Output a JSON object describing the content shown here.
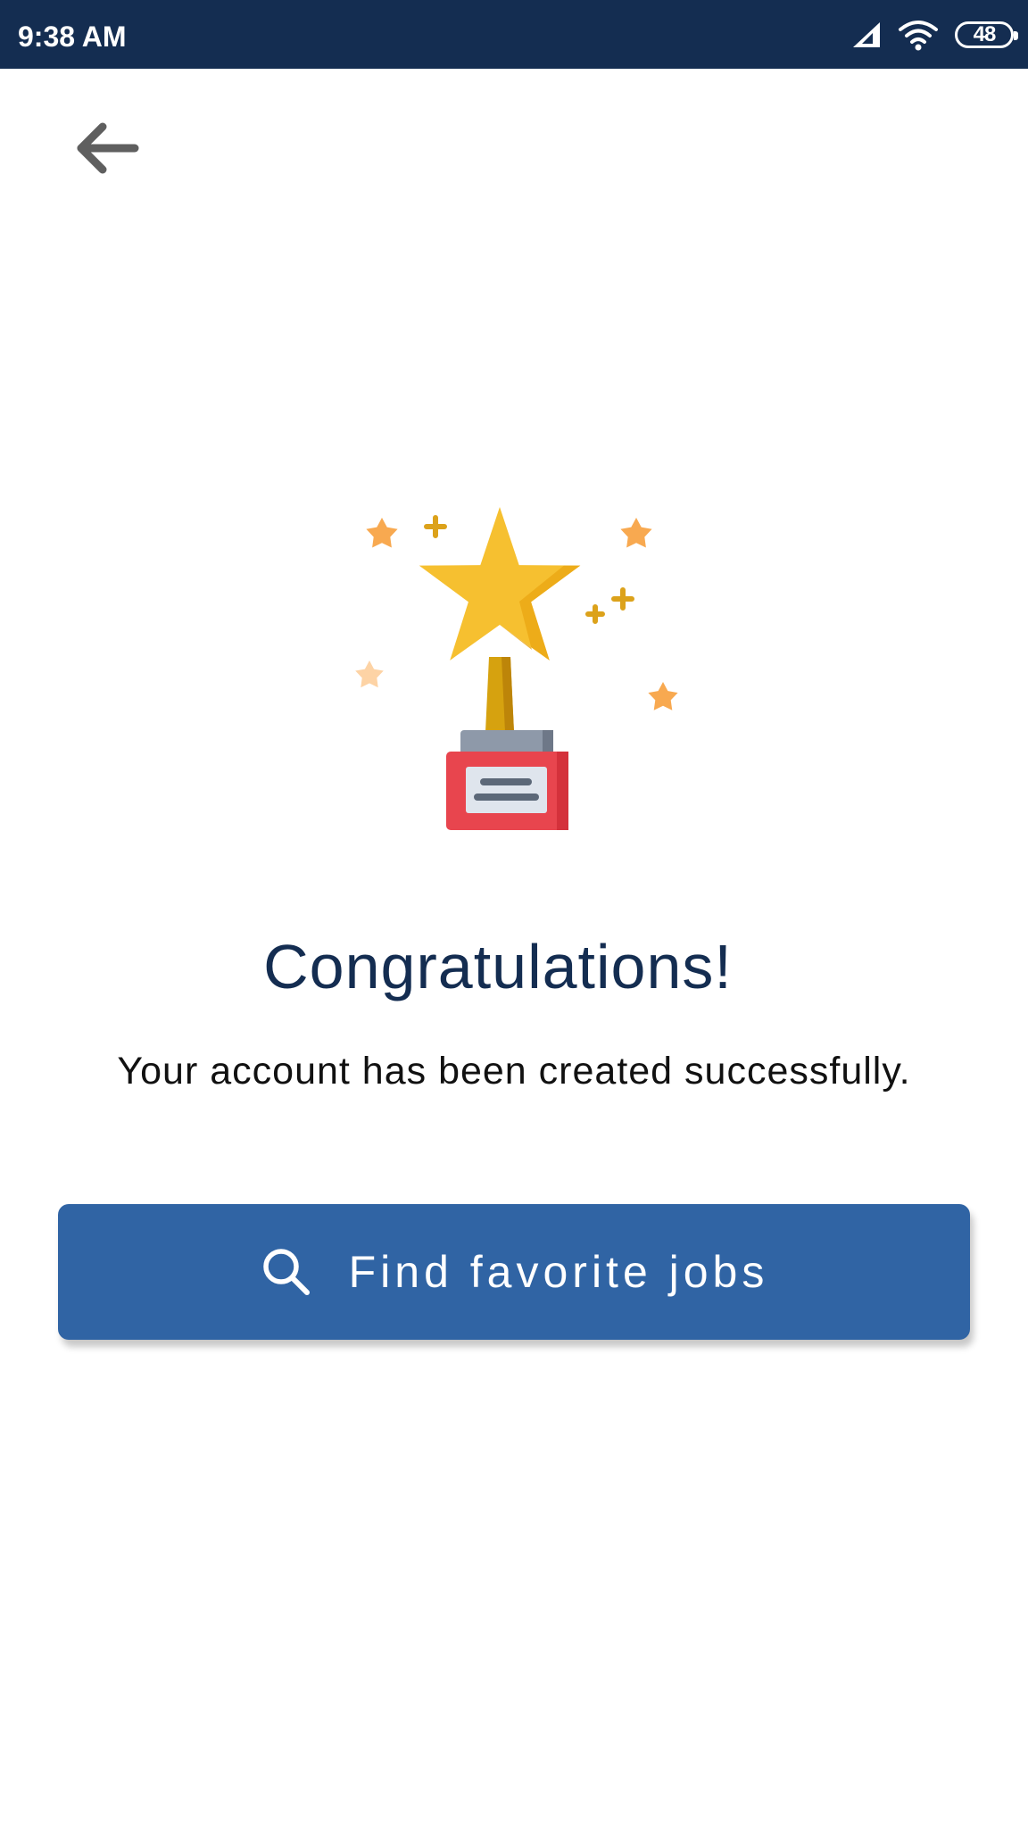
{
  "status_bar": {
    "time": "9:38 AM",
    "battery": "48",
    "icons": [
      "signal-icon",
      "wifi-icon",
      "battery-icon"
    ]
  },
  "navigation": {
    "back_icon": "arrow-left-icon"
  },
  "illustration": {
    "icon": "trophy-star-icon"
  },
  "content": {
    "title": "Congratulations!",
    "message": "Your account has been created successfully."
  },
  "cta": {
    "label": "Find favorite jobs",
    "icon": "search-icon"
  },
  "colors": {
    "status_bar": "#142d51",
    "title_text": "#142d51",
    "button": "#3064a4",
    "button_text": "#ffffff"
  }
}
